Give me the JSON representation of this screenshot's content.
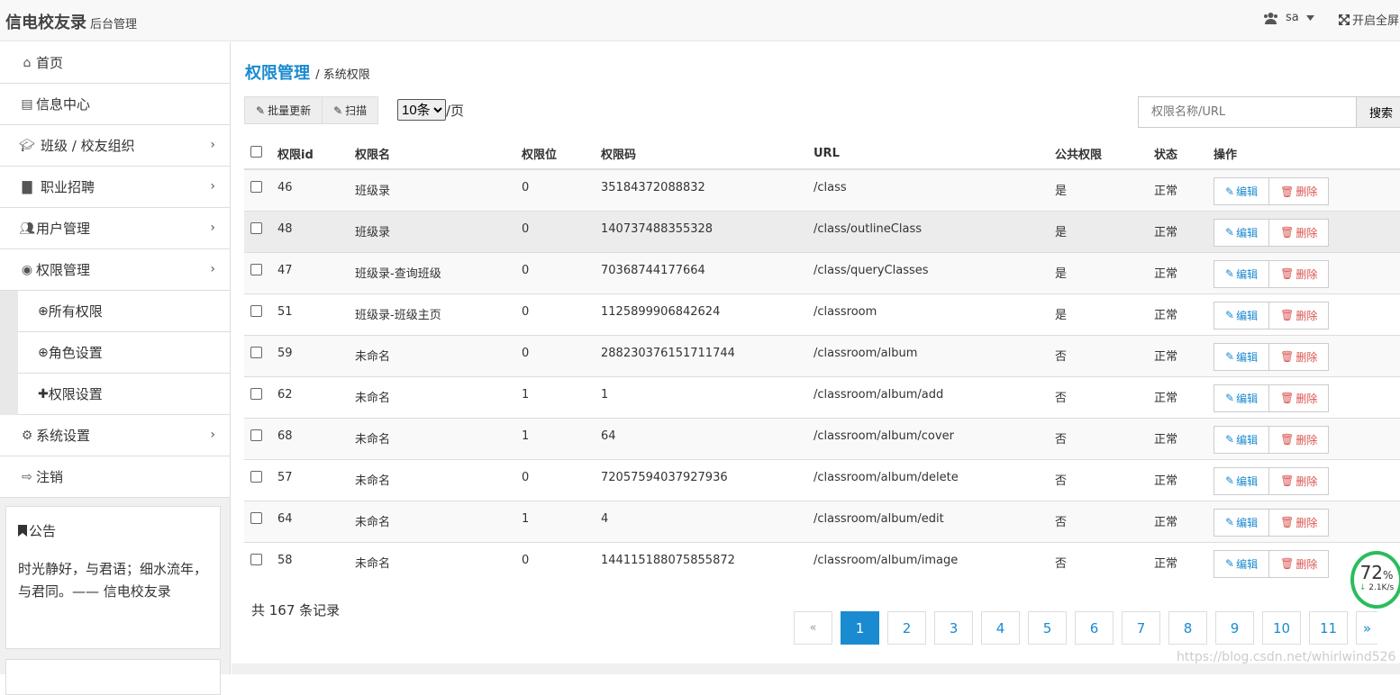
{
  "header": {
    "brand": "信电校友录",
    "brand_sub": "后台管理",
    "user": "sa",
    "fullscreen": "开启全屏"
  },
  "sidebar": {
    "items": [
      {
        "label": "首页",
        "icon": "home-icon"
      },
      {
        "label": "信息中心",
        "icon": "newspaper-icon"
      },
      {
        "label": "班级 / 校友组织",
        "icon": "graduation-cap-icon"
      },
      {
        "label": "职业招聘",
        "icon": "briefcase-icon"
      },
      {
        "label": "用户管理",
        "icon": "users-icon"
      },
      {
        "label": "权限管理",
        "icon": "eye-icon"
      }
    ],
    "subitems": [
      {
        "label": "所有权限",
        "icon": "search-plus-icon"
      },
      {
        "label": "角色设置",
        "icon": "search-plus-icon"
      },
      {
        "label": "权限设置",
        "icon": "puzzle-icon"
      }
    ],
    "items_after": [
      {
        "label": "系统设置",
        "icon": "cogs-icon"
      },
      {
        "label": "注销",
        "icon": "sign-out-icon"
      }
    ],
    "notice_title": "公告",
    "notice_text": "时光静好，与君语；细水流年，与君同。—— 信电校友录"
  },
  "main": {
    "breadcrumb_title": "权限管理",
    "breadcrumb_sub": "/ 系统权限",
    "toolbar": {
      "batch_update": "批量更新",
      "scan": "扫描"
    },
    "page_size": "10条",
    "page_size_suffix": "/页",
    "search_placeholder": "权限名称/URL",
    "search_button": "搜索",
    "columns": [
      "权限id",
      "权限名",
      "权限位",
      "权限码",
      "URL",
      "公共权限",
      "状态",
      "操作"
    ],
    "rows": [
      {
        "id": "46",
        "name": "班级录",
        "pos": "0",
        "code": "35184372088832",
        "url": "/class",
        "public": "是",
        "status": "正常"
      },
      {
        "id": "48",
        "name": "班级录",
        "pos": "0",
        "code": "140737488355328",
        "url": "/class/outlineClass",
        "public": "是",
        "status": "正常"
      },
      {
        "id": "47",
        "name": "班级录-查询班级",
        "pos": "0",
        "code": "70368744177664",
        "url": "/class/queryClasses",
        "public": "是",
        "status": "正常"
      },
      {
        "id": "51",
        "name": "班级录-班级主页",
        "pos": "0",
        "code": "1125899906842624",
        "url": "/classroom",
        "public": "是",
        "status": "正常"
      },
      {
        "id": "59",
        "name": "未命名",
        "pos": "0",
        "code": "288230376151711744",
        "url": "/classroom/album",
        "public": "否",
        "status": "正常"
      },
      {
        "id": "62",
        "name": "未命名",
        "pos": "1",
        "code": "1",
        "url": "/classroom/album/add",
        "public": "否",
        "status": "正常"
      },
      {
        "id": "68",
        "name": "未命名",
        "pos": "1",
        "code": "64",
        "url": "/classroom/album/cover",
        "public": "否",
        "status": "正常"
      },
      {
        "id": "57",
        "name": "未命名",
        "pos": "0",
        "code": "72057594037927936",
        "url": "/classroom/album/delete",
        "public": "否",
        "status": "正常"
      },
      {
        "id": "64",
        "name": "未命名",
        "pos": "1",
        "code": "4",
        "url": "/classroom/album/edit",
        "public": "否",
        "status": "正常"
      },
      {
        "id": "58",
        "name": "未命名",
        "pos": "0",
        "code": "144115188075855872",
        "url": "/classroom/album/image",
        "public": "否",
        "status": "正常"
      }
    ],
    "edit_label": "编辑",
    "delete_label": "删除",
    "total": "共 167 条记录",
    "pager": [
      "«",
      "1",
      "2",
      "3",
      "4",
      "5",
      "6",
      "7",
      "8",
      "9",
      "10",
      "11",
      "»"
    ],
    "active_page": "1"
  },
  "overlay": {
    "gauge_pct": "72",
    "gauge_unit": "%",
    "gauge_speed": "2.1K/s",
    "watermark": "https://blog.csdn.net/whirlwind526"
  },
  "colors": {
    "accent": "#1a8bd0",
    "danger": "#d9534f",
    "gauge": "#2bbd5c"
  }
}
